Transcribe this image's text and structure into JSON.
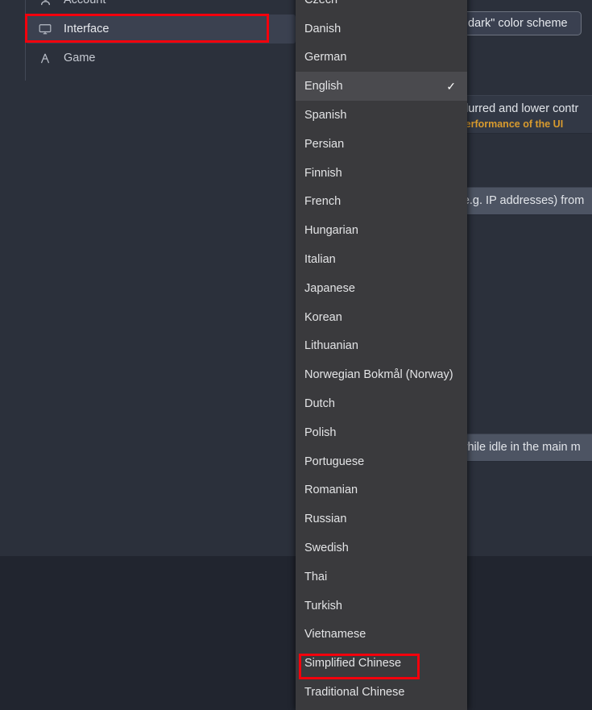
{
  "sidebar": {
    "items": [
      {
        "label": "Account",
        "icon": "user-icon",
        "selected": false
      },
      {
        "label": "Interface",
        "icon": "monitor-icon",
        "selected": true
      },
      {
        "label": "Game",
        "icon": "compass-icon",
        "selected": false
      }
    ]
  },
  "settings_rows": {
    "color_scheme_button": "dark\" color scheme",
    "rows": [
      {
        "text": "blurred and lower contr",
        "warning": "performance of the UI",
        "hover": false
      },
      {
        "text": "(e.g. IP addresses) from",
        "warning": "",
        "hover": true
      },
      {
        "text": "while idle in the main m",
        "warning": "",
        "hover": true
      }
    ]
  },
  "language_dropdown": {
    "selected": "English",
    "check_glyph": "✓",
    "items": [
      {
        "label": "Czech"
      },
      {
        "label": "Danish"
      },
      {
        "label": "German"
      },
      {
        "label": "English"
      },
      {
        "label": "Spanish"
      },
      {
        "label": "Persian"
      },
      {
        "label": "Finnish"
      },
      {
        "label": "French"
      },
      {
        "label": "Hungarian"
      },
      {
        "label": "Italian"
      },
      {
        "label": "Japanese"
      },
      {
        "label": "Korean"
      },
      {
        "label": "Lithuanian"
      },
      {
        "label": "Norwegian Bokmål (Norway)"
      },
      {
        "label": "Dutch"
      },
      {
        "label": "Polish"
      },
      {
        "label": "Portuguese"
      },
      {
        "label": "Romanian"
      },
      {
        "label": "Russian"
      },
      {
        "label": "Swedish"
      },
      {
        "label": "Thai"
      },
      {
        "label": "Turkish"
      },
      {
        "label": "Vietnamese"
      },
      {
        "label": "Simplified Chinese"
      },
      {
        "label": "Traditional Chinese"
      }
    ]
  },
  "annotations": {
    "highlight_interface": "Interface",
    "highlight_language": "Simplified Chinese",
    "highlight_color": "#f4000c"
  }
}
